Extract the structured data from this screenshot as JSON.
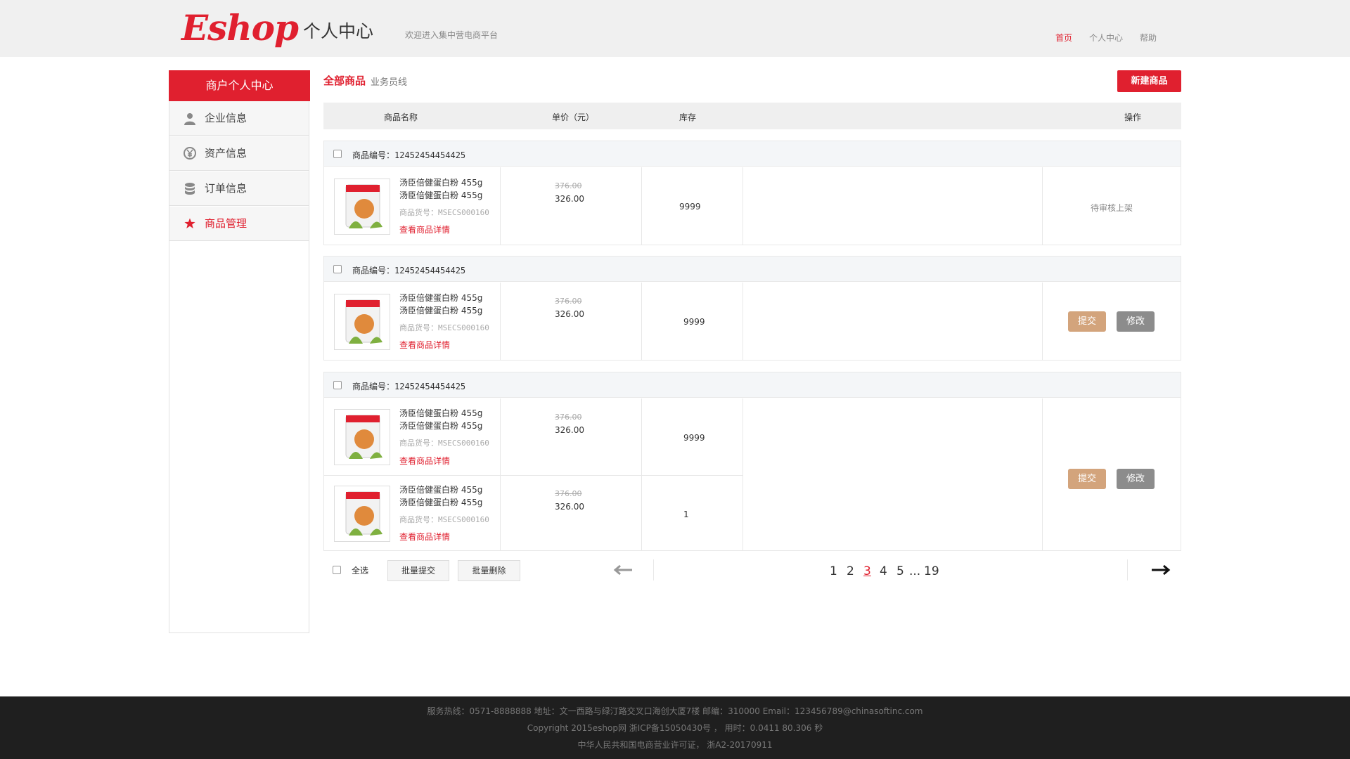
{
  "header": {
    "logo": "Eshop",
    "title": "个人中心",
    "subtitle": "欢迎进入集中营电商平台",
    "nav": [
      "首页",
      "个人中心",
      "帮助"
    ],
    "active_color": "#e0202f"
  },
  "sidebar": {
    "title": "商户个人中心",
    "items": [
      {
        "label": "企业信息",
        "icon": "user-icon"
      },
      {
        "label": "资产信息",
        "icon": "yen-icon"
      },
      {
        "label": "订单信息",
        "icon": "database-icon"
      },
      {
        "label": "商品管理",
        "icon": "star-icon",
        "active": true
      }
    ]
  },
  "tabs": {
    "active": "全部商品",
    "other": "业务员线"
  },
  "new_button": "新建商品",
  "table_headers": [
    "商品名称",
    "单价（元）",
    "库存",
    "操作"
  ],
  "groups": [
    {
      "id_label": "商品编号：12452454454425",
      "products": [
        {
          "title1": "汤臣倍健蛋白粉 455g",
          "title2": "汤臣倍健蛋白粉 455g",
          "sku": "商品货号：MSECS000160",
          "link": "查看商品详情",
          "old_price": "376.00",
          "price": "326.00",
          "stock": "9999"
        }
      ],
      "status": "待审核上架"
    },
    {
      "id_label": "商品编号：12452454454425",
      "products": [
        {
          "title1": "汤臣倍健蛋白粉 455g",
          "title2": "汤臣倍健蛋白粉 455g",
          "sku": "商品货号：MSECS000160",
          "link": "查看商品详情",
          "old_price": "376.00",
          "price": "326.00",
          "stock": "9999"
        }
      ],
      "actions": [
        "提交",
        "修改"
      ]
    },
    {
      "id_label": "商品编号：12452454454425",
      "products": [
        {
          "title1": "汤臣倍健蛋白粉 455g",
          "title2": "汤臣倍健蛋白粉 455g",
          "sku": "商品货号：MSECS000160",
          "link": "查看商品详情",
          "old_price": "376.00",
          "price": "326.00",
          "stock": "9999"
        },
        {
          "title1": "汤臣倍健蛋白粉 455g",
          "title2": "汤臣倍健蛋白粉 455g",
          "sku": "商品货号：MSECS000160",
          "link": "查看商品详情",
          "old_price": "376.00",
          "price": "326.00",
          "stock": "1"
        }
      ],
      "actions": [
        "提交",
        "修改"
      ]
    }
  ],
  "bottom": {
    "select_all": "全选",
    "batch_submit": "批量提交",
    "batch_delete": "批量删除",
    "pages": [
      "1",
      "2",
      "3",
      "4",
      "5",
      "...",
      "19"
    ],
    "current_page": "3",
    "prev_icon": "arrow-left-icon",
    "next_icon": "arrow-right-icon"
  },
  "footer": {
    "line1": "服务热线：0571-8888888      地址：文一西路与绿汀路交叉口海创大厦7楼      邮编：310000      Email：123456789@chinasoftinc.com",
    "line2": "Copyright 2015eshop网    浙ICP备15050430号 ，  用时：0.0411 80.306 秒",
    "line3": "中华人民共和国电商营业许可证，  浙A2-20170911"
  }
}
